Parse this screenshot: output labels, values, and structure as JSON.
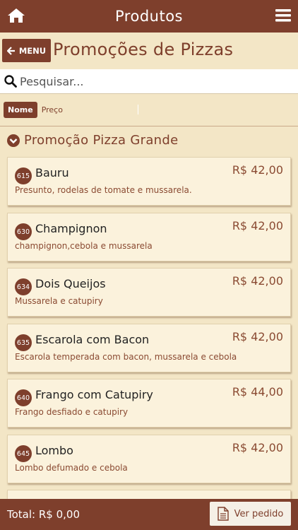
{
  "topbar": {
    "title": "Produtos",
    "home_icon": "home-icon",
    "menu_icon": "hamburger-icon"
  },
  "header": {
    "back_label": "MENU",
    "title": "Promoções de Pizzas"
  },
  "search": {
    "placeholder": "Pesquisar..."
  },
  "sort": {
    "active": "Nome",
    "other": "Preço"
  },
  "group": {
    "label": "Promoção Pizza Grande",
    "icon": "chevron-down-circle-icon"
  },
  "products": [
    {
      "code": "615",
      "name": "Bauru",
      "price": "R$ 42,00",
      "desc": "Presunto, rodelas de tomate e mussarela."
    },
    {
      "code": "630",
      "name": "Champignon",
      "price": "R$ 42,00",
      "desc": "champignon,cebola e mussarela"
    },
    {
      "code": "634",
      "name": "Dois Queijos",
      "price": "R$ 42,00",
      "desc": "Mussarela e catupiry"
    },
    {
      "code": "635",
      "name": "Escarola com Bacon",
      "price": "R$ 42,00",
      "desc": "Escarola temperada com bacon, mussarela e cebola"
    },
    {
      "code": "640",
      "name": "Frango com Catupiry",
      "price": "R$ 44,00",
      "desc": "Frango desfiado e catupiry"
    },
    {
      "code": "645",
      "name": "Lombo",
      "price": "R$ 42,00",
      "desc": "Lombo defumado e cebola"
    }
  ],
  "footer": {
    "total": "Total: R$ 0,00",
    "order_label": "Ver pedido"
  },
  "colors": {
    "primary": "#7e3f2c",
    "background": "#f3e6c6",
    "card": "#fbf2dc"
  }
}
